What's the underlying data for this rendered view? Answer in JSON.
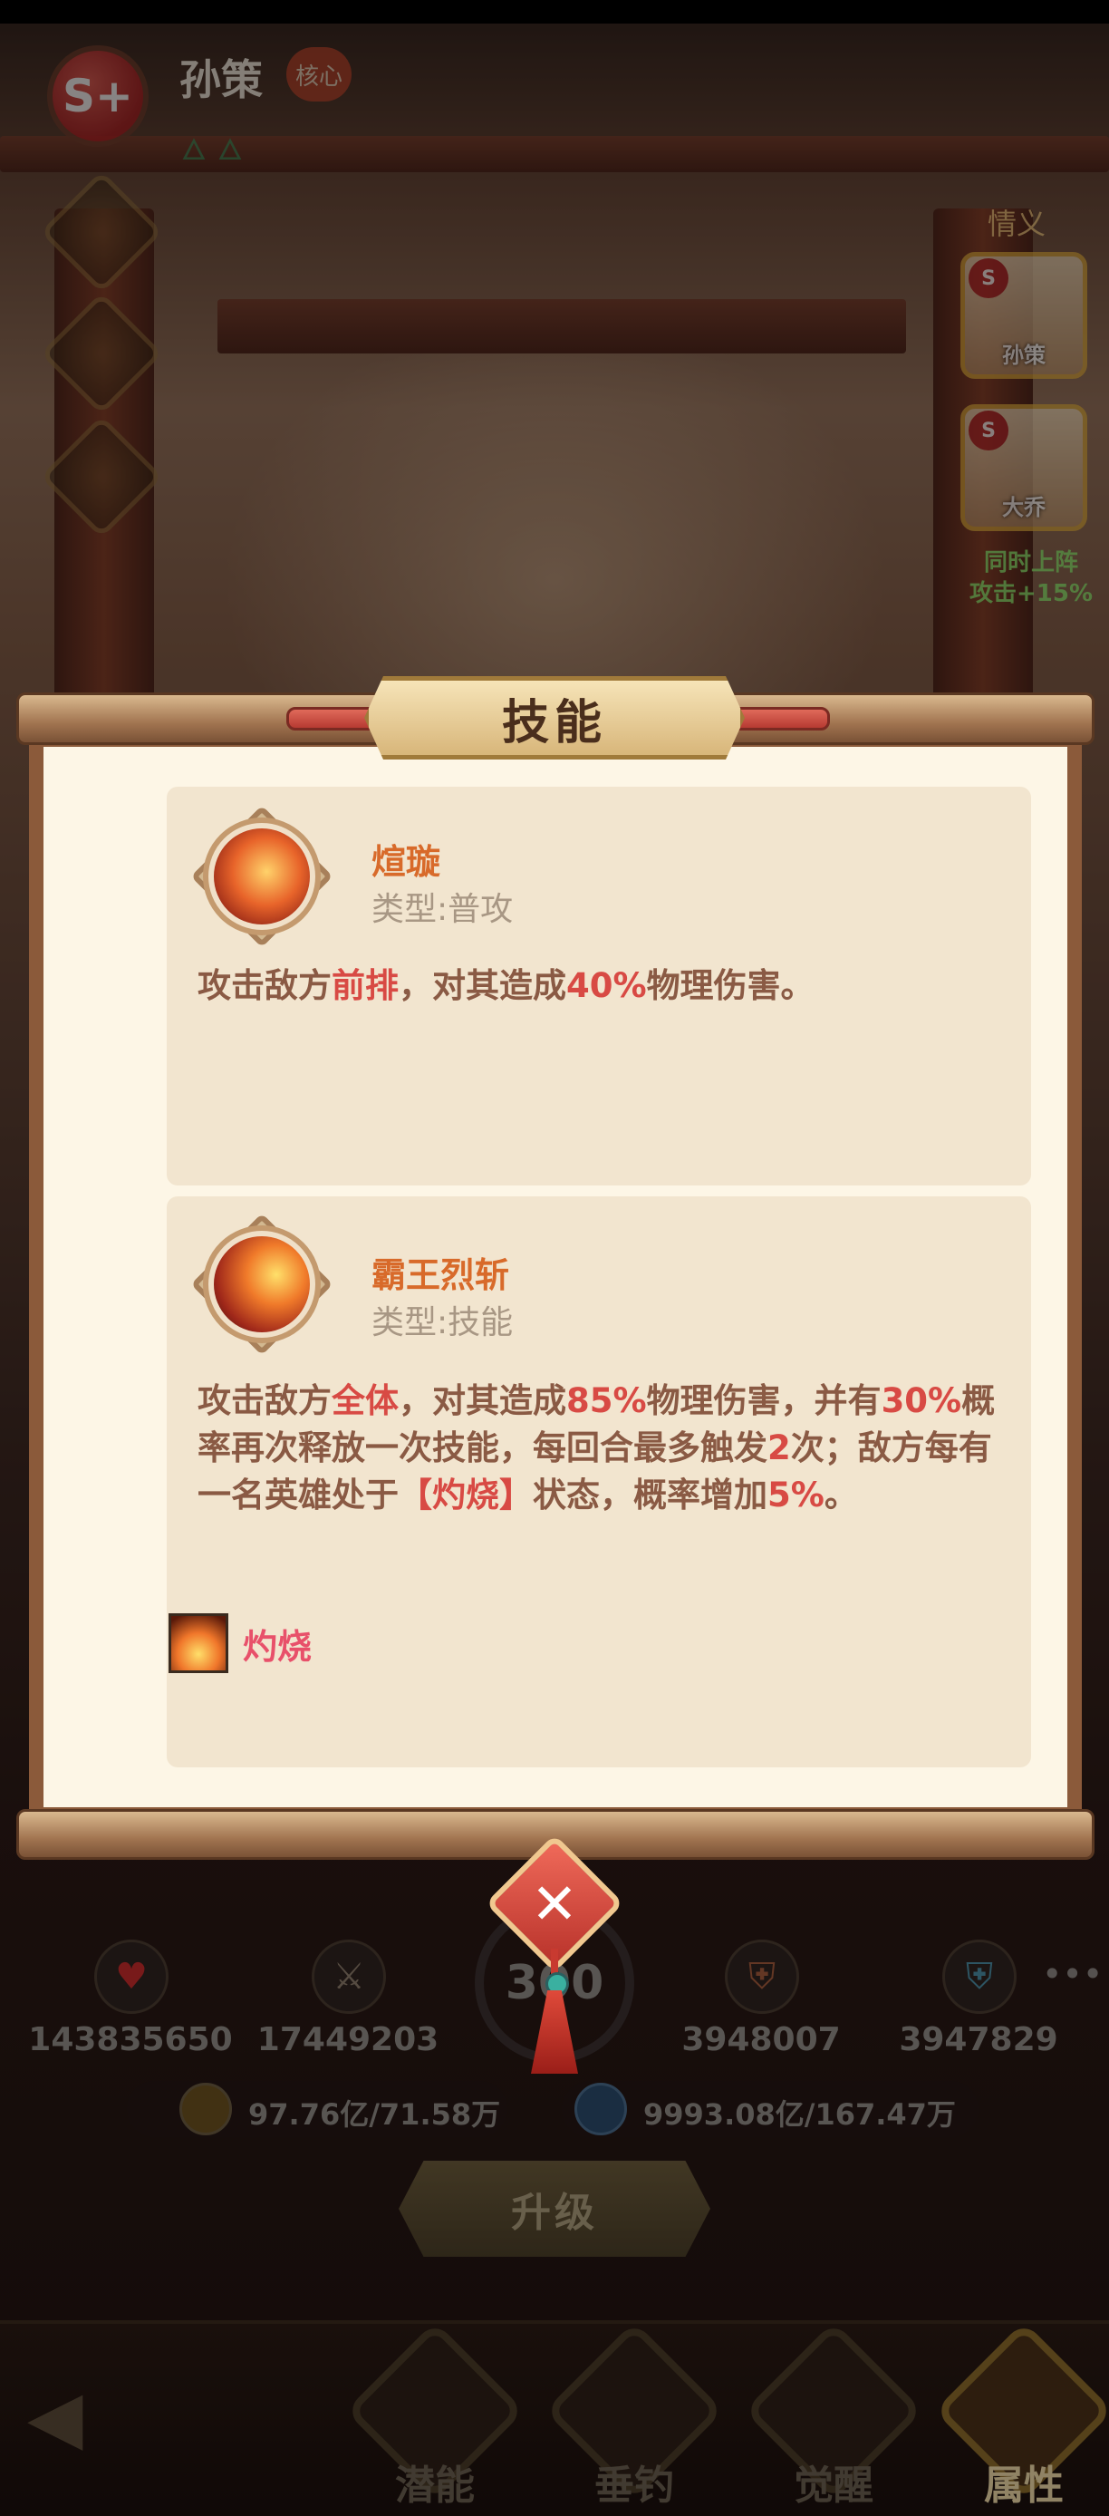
{
  "header": {
    "grade": "S+",
    "hero_name": "孙策",
    "core_badge": "核心"
  },
  "bond_panel": {
    "title": "情义",
    "members": [
      {
        "grade": "S",
        "name": "孙策"
      },
      {
        "grade": "S",
        "name": "大乔"
      }
    ],
    "note_line1": "同时上阵",
    "note_line2": "攻击+15%"
  },
  "modal": {
    "title": "技能",
    "skills": [
      {
        "name": "煊璇",
        "type": "类型:普攻",
        "desc_parts": [
          "攻击敌方",
          "前排",
          "，对其造成",
          "40%",
          "物理伤害。"
        ]
      },
      {
        "name": "霸王烈斩",
        "type": "类型:技能",
        "desc_parts": [
          "攻击敌方",
          "全体",
          "，对其造成",
          "85%",
          "物理伤害，并有",
          "30%",
          "概率再次释放一次技能，每回合最多触发",
          "2",
          "次；敌方每有一名英雄处于",
          "【灼烧】",
          "状态，概率增加",
          "5%",
          "。"
        ],
        "status_effect": "灼烧"
      }
    ],
    "close_icon": "close-x-icon"
  },
  "stats": {
    "hp": "143835650",
    "attack": "17449203",
    "level": "300",
    "phys_def": "3948007",
    "magic_def": "3947829",
    "gold": "97.76亿/71.58万",
    "exp": "9993.08亿/167.47万",
    "upgrade_label": "升级"
  },
  "nav": {
    "potential": "潜能",
    "fishing": "垂钓",
    "awaken": "觉醒",
    "attributes": "属性"
  },
  "colors": {
    "highlight": "#d84a44",
    "skill_name": "#d86a2a",
    "paper": "#fdf6e6"
  }
}
